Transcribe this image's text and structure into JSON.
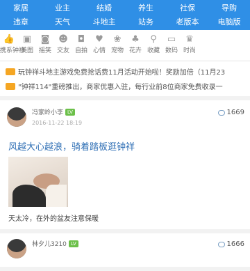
{
  "nav": {
    "row1": [
      "家居",
      "业主",
      "结婚",
      "养生",
      "社保",
      "导购"
    ],
    "row2": [
      "违章",
      "天气",
      "斗地主",
      "站务",
      "老版本",
      "电脑版"
    ]
  },
  "categories": [
    {
      "icon": "thumb-icon",
      "glyph": "👍",
      "label": "携系钟祥"
    },
    {
      "icon": "image-icon",
      "glyph": "▣",
      "label": "美图"
    },
    {
      "icon": "camera-icon",
      "glyph": "◙",
      "label": "摇笑"
    },
    {
      "icon": "friends-icon",
      "glyph": "☻",
      "label": "交友"
    },
    {
      "icon": "selfie-icon",
      "glyph": "◘",
      "label": "自拍"
    },
    {
      "icon": "heart-icon",
      "glyph": "♥",
      "label": "心情"
    },
    {
      "icon": "pet-icon",
      "glyph": "❀",
      "label": "宠物"
    },
    {
      "icon": "flower-icon",
      "glyph": "♣",
      "label": "花卉"
    },
    {
      "icon": "search-icon",
      "glyph": "⚲",
      "label": "收藏"
    },
    {
      "icon": "digital-icon",
      "glyph": "▭",
      "label": "数码"
    },
    {
      "icon": "fashion-icon",
      "glyph": "♛",
      "label": "时尚"
    }
  ],
  "notices": [
    "玩钟祥斗地主游戏免费抢话费11月活动开始啦！奖励加倍（11月23",
    "\"钟祥114\"重磅推出，商家优惠入驻，每行业前8位商家免费收录一"
  ],
  "posts": [
    {
      "author": "冯家岭小李",
      "level": "LV",
      "time": "2016-11-22 18:19",
      "comments": "1669",
      "title": "风越大心越浪，骑着踏板逛钟祥",
      "caption": "天太冷，在外的盆友注意保暖"
    },
    {
      "author": "林夕儿3210",
      "level": "LV",
      "comments": "1666"
    }
  ]
}
